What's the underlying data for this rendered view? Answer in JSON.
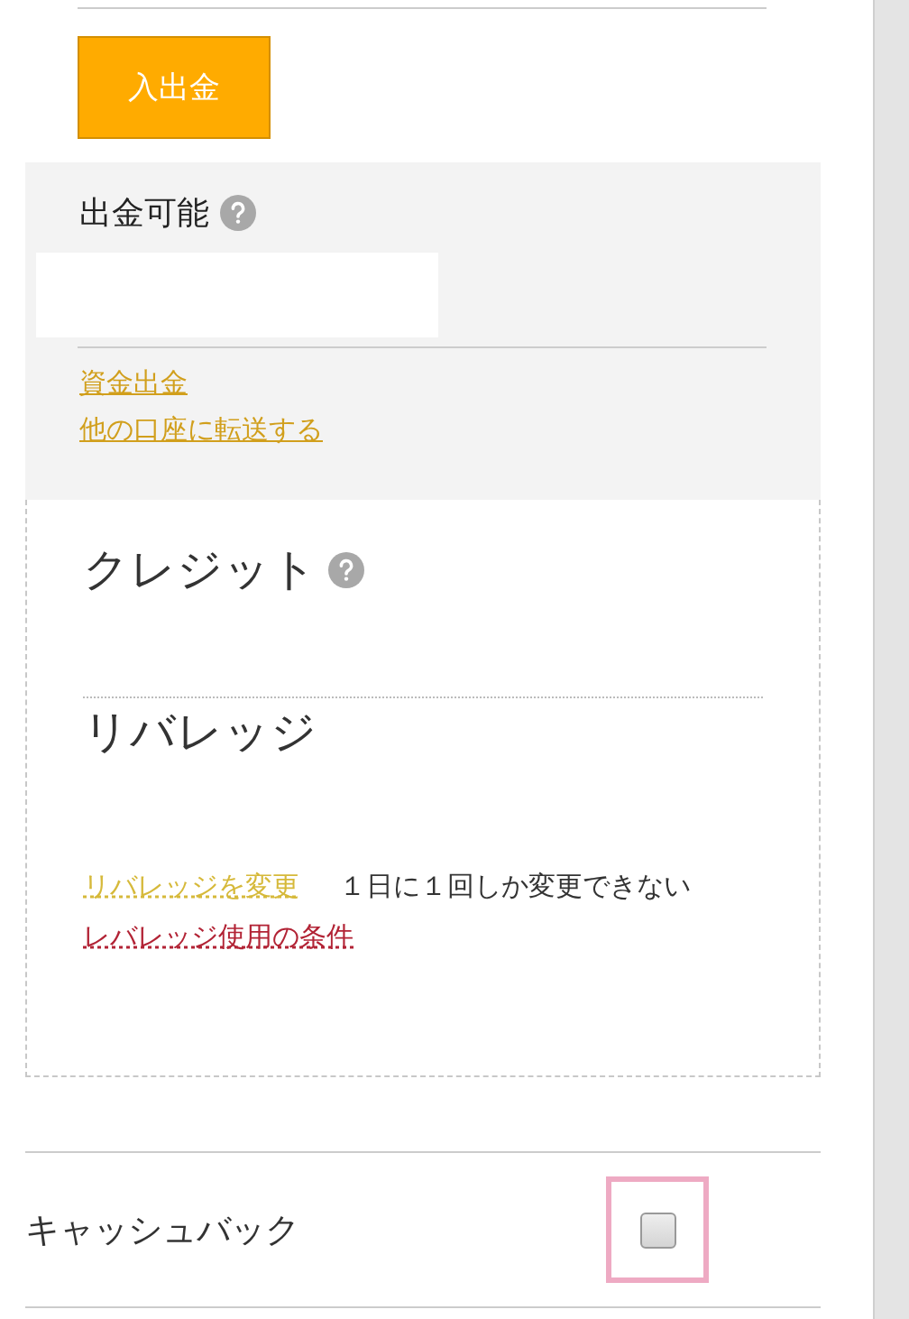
{
  "deposit_button": {
    "label": "入出金"
  },
  "withdrawable": {
    "title": "出金可能",
    "links": [
      "資金出金",
      "他の口座に転送する"
    ]
  },
  "credit": {
    "title": "クレジット"
  },
  "leverage": {
    "title": "リバレッジ",
    "change_link": "リバレッジを変更",
    "note": "１日に１回しか変更できない",
    "conditions_link": "レバレッジ使用の条件"
  },
  "cashback": {
    "label": "キャッシュバック",
    "checked": false
  }
}
